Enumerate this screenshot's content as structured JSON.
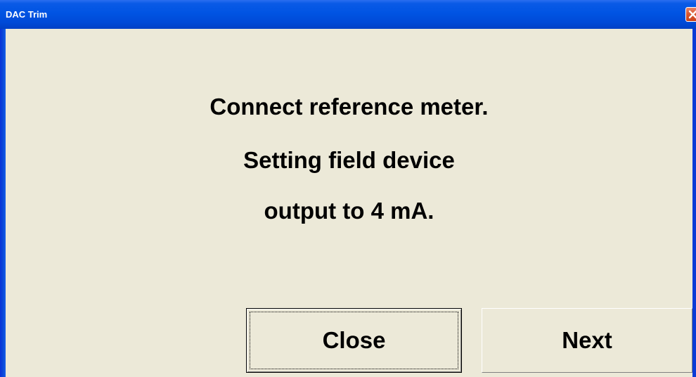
{
  "window": {
    "title": "DAC Trim"
  },
  "message": {
    "line1": "Connect reference meter.",
    "line2": "Setting field device",
    "line3": "output to 4 mA."
  },
  "buttons": {
    "close_label": "Close",
    "next_label": "Next"
  },
  "colors": {
    "titlebar": "#0054e3",
    "client_background": "#ece9d8",
    "close_button": "#d9572f"
  },
  "icons": {
    "title_close": "close-icon"
  }
}
